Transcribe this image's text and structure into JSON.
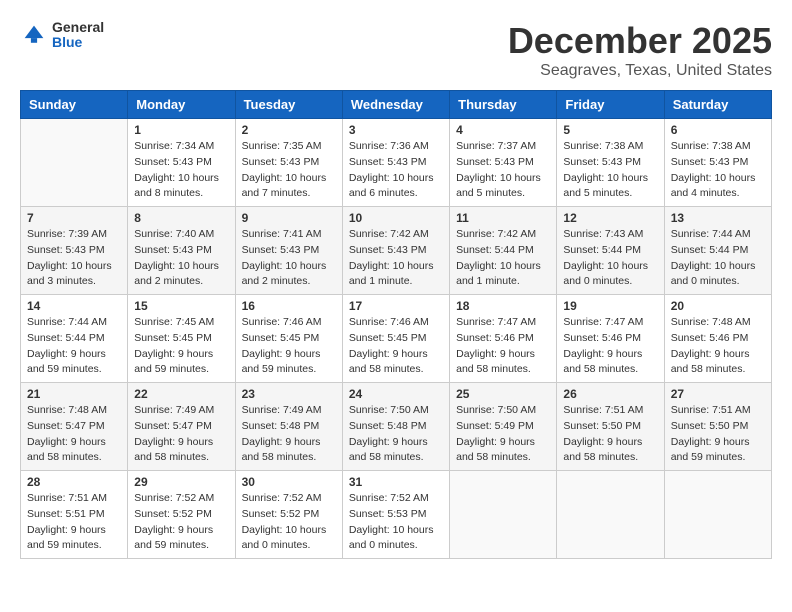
{
  "header": {
    "logo_general": "General",
    "logo_blue": "Blue",
    "month_title": "December 2025",
    "location": "Seagraves, Texas, United States"
  },
  "days_of_week": [
    "Sunday",
    "Monday",
    "Tuesday",
    "Wednesday",
    "Thursday",
    "Friday",
    "Saturday"
  ],
  "weeks": [
    [
      {
        "day": "",
        "info": ""
      },
      {
        "day": "1",
        "info": "Sunrise: 7:34 AM\nSunset: 5:43 PM\nDaylight: 10 hours\nand 8 minutes."
      },
      {
        "day": "2",
        "info": "Sunrise: 7:35 AM\nSunset: 5:43 PM\nDaylight: 10 hours\nand 7 minutes."
      },
      {
        "day": "3",
        "info": "Sunrise: 7:36 AM\nSunset: 5:43 PM\nDaylight: 10 hours\nand 6 minutes."
      },
      {
        "day": "4",
        "info": "Sunrise: 7:37 AM\nSunset: 5:43 PM\nDaylight: 10 hours\nand 5 minutes."
      },
      {
        "day": "5",
        "info": "Sunrise: 7:38 AM\nSunset: 5:43 PM\nDaylight: 10 hours\nand 5 minutes."
      },
      {
        "day": "6",
        "info": "Sunrise: 7:38 AM\nSunset: 5:43 PM\nDaylight: 10 hours\nand 4 minutes."
      }
    ],
    [
      {
        "day": "7",
        "info": "Sunrise: 7:39 AM\nSunset: 5:43 PM\nDaylight: 10 hours\nand 3 minutes."
      },
      {
        "day": "8",
        "info": "Sunrise: 7:40 AM\nSunset: 5:43 PM\nDaylight: 10 hours\nand 2 minutes."
      },
      {
        "day": "9",
        "info": "Sunrise: 7:41 AM\nSunset: 5:43 PM\nDaylight: 10 hours\nand 2 minutes."
      },
      {
        "day": "10",
        "info": "Sunrise: 7:42 AM\nSunset: 5:43 PM\nDaylight: 10 hours\nand 1 minute."
      },
      {
        "day": "11",
        "info": "Sunrise: 7:42 AM\nSunset: 5:44 PM\nDaylight: 10 hours\nand 1 minute."
      },
      {
        "day": "12",
        "info": "Sunrise: 7:43 AM\nSunset: 5:44 PM\nDaylight: 10 hours\nand 0 minutes."
      },
      {
        "day": "13",
        "info": "Sunrise: 7:44 AM\nSunset: 5:44 PM\nDaylight: 10 hours\nand 0 minutes."
      }
    ],
    [
      {
        "day": "14",
        "info": "Sunrise: 7:44 AM\nSunset: 5:44 PM\nDaylight: 9 hours\nand 59 minutes."
      },
      {
        "day": "15",
        "info": "Sunrise: 7:45 AM\nSunset: 5:45 PM\nDaylight: 9 hours\nand 59 minutes."
      },
      {
        "day": "16",
        "info": "Sunrise: 7:46 AM\nSunset: 5:45 PM\nDaylight: 9 hours\nand 59 minutes."
      },
      {
        "day": "17",
        "info": "Sunrise: 7:46 AM\nSunset: 5:45 PM\nDaylight: 9 hours\nand 58 minutes."
      },
      {
        "day": "18",
        "info": "Sunrise: 7:47 AM\nSunset: 5:46 PM\nDaylight: 9 hours\nand 58 minutes."
      },
      {
        "day": "19",
        "info": "Sunrise: 7:47 AM\nSunset: 5:46 PM\nDaylight: 9 hours\nand 58 minutes."
      },
      {
        "day": "20",
        "info": "Sunrise: 7:48 AM\nSunset: 5:46 PM\nDaylight: 9 hours\nand 58 minutes."
      }
    ],
    [
      {
        "day": "21",
        "info": "Sunrise: 7:48 AM\nSunset: 5:47 PM\nDaylight: 9 hours\nand 58 minutes."
      },
      {
        "day": "22",
        "info": "Sunrise: 7:49 AM\nSunset: 5:47 PM\nDaylight: 9 hours\nand 58 minutes."
      },
      {
        "day": "23",
        "info": "Sunrise: 7:49 AM\nSunset: 5:48 PM\nDaylight: 9 hours\nand 58 minutes."
      },
      {
        "day": "24",
        "info": "Sunrise: 7:50 AM\nSunset: 5:48 PM\nDaylight: 9 hours\nand 58 minutes."
      },
      {
        "day": "25",
        "info": "Sunrise: 7:50 AM\nSunset: 5:49 PM\nDaylight: 9 hours\nand 58 minutes."
      },
      {
        "day": "26",
        "info": "Sunrise: 7:51 AM\nSunset: 5:50 PM\nDaylight: 9 hours\nand 58 minutes."
      },
      {
        "day": "27",
        "info": "Sunrise: 7:51 AM\nSunset: 5:50 PM\nDaylight: 9 hours\nand 59 minutes."
      }
    ],
    [
      {
        "day": "28",
        "info": "Sunrise: 7:51 AM\nSunset: 5:51 PM\nDaylight: 9 hours\nand 59 minutes."
      },
      {
        "day": "29",
        "info": "Sunrise: 7:52 AM\nSunset: 5:52 PM\nDaylight: 9 hours\nand 59 minutes."
      },
      {
        "day": "30",
        "info": "Sunrise: 7:52 AM\nSunset: 5:52 PM\nDaylight: 10 hours\nand 0 minutes."
      },
      {
        "day": "31",
        "info": "Sunrise: 7:52 AM\nSunset: 5:53 PM\nDaylight: 10 hours\nand 0 minutes."
      },
      {
        "day": "",
        "info": ""
      },
      {
        "day": "",
        "info": ""
      },
      {
        "day": "",
        "info": ""
      }
    ]
  ]
}
